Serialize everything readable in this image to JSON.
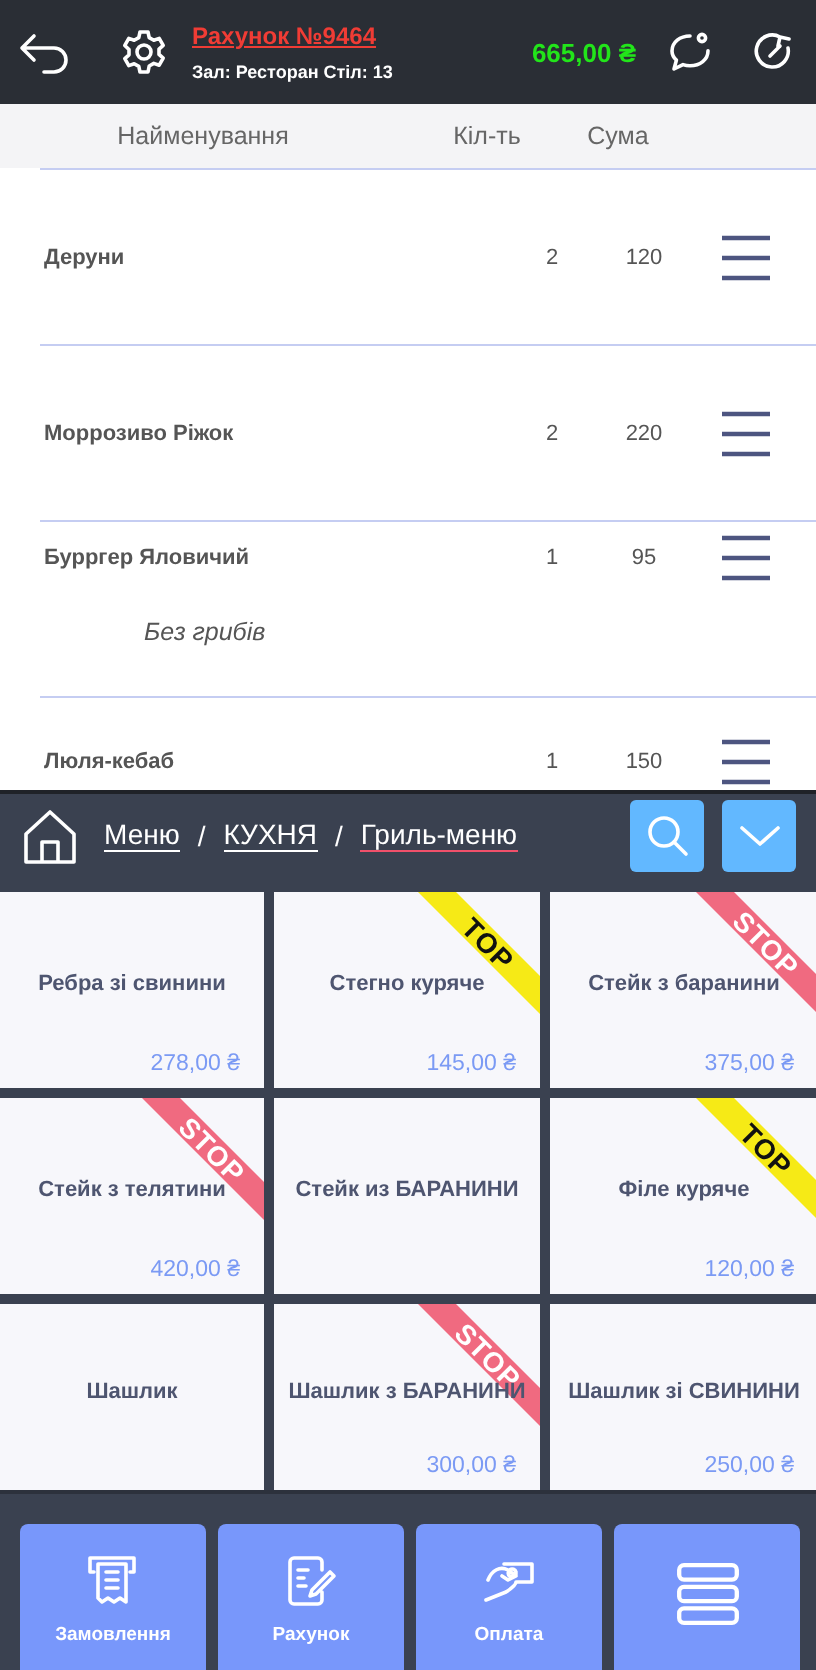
{
  "header": {
    "title": "Рахунок №9464",
    "subtitle": "Зал: Ресторан Стіл: 13",
    "total": "665,00 ₴"
  },
  "columns": [
    "Найменування",
    "Кіл-ть",
    "Сума"
  ],
  "order_items": [
    {
      "name": "Деруни",
      "qty": "2",
      "sum": "120"
    },
    {
      "name": "Моррозиво Ріжок",
      "qty": "2",
      "sum": "220"
    },
    {
      "name": "Бурргер Яловичий",
      "qty": "1",
      "sum": "95",
      "note": "Без грибів"
    },
    {
      "name": "Люля-кебаб",
      "qty": "1",
      "sum": "150"
    }
  ],
  "breadcrumb": {
    "separator": "/",
    "items": [
      {
        "label": "Меню",
        "selected": false
      },
      {
        "label": "КУХНЯ",
        "selected": false
      },
      {
        "label": "Гриль-меню",
        "selected": true
      }
    ]
  },
  "menu_items": [
    {
      "name": "Ребра зі свинини",
      "price": "278,00 ₴"
    },
    {
      "name": "Стегно куряче",
      "price": "145,00 ₴",
      "ribbon": {
        "kind": "top",
        "label": "TOP"
      }
    },
    {
      "name": "Стейк з баранини",
      "price": "375,00 ₴",
      "ribbon": {
        "kind": "stop",
        "label": "STOP"
      }
    },
    {
      "name": "Стейк з телятини",
      "price": "420,00 ₴",
      "ribbon": {
        "kind": "stop",
        "label": "STOP"
      }
    },
    {
      "name": "Стейк из БАРАНИНИ"
    },
    {
      "name": "Філе куряче",
      "price": "120,00 ₴",
      "ribbon": {
        "kind": "top",
        "label": "TOP"
      }
    },
    {
      "name": "Шашлик"
    },
    {
      "name": "Шашлик з БАРАНИНИ",
      "price": "300,00 ₴",
      "ribbon": {
        "kind": "stop",
        "label": "STOP"
      }
    },
    {
      "name": "Шашлик зі СВИНИНИ",
      "price": "250,00 ₴"
    }
  ],
  "actions": [
    {
      "kind": "receipt",
      "label": "Замовлення"
    },
    {
      "kind": "bill",
      "label": "Рахунок"
    },
    {
      "kind": "payment",
      "label": "Оплата"
    },
    {
      "kind": "list"
    }
  ]
}
